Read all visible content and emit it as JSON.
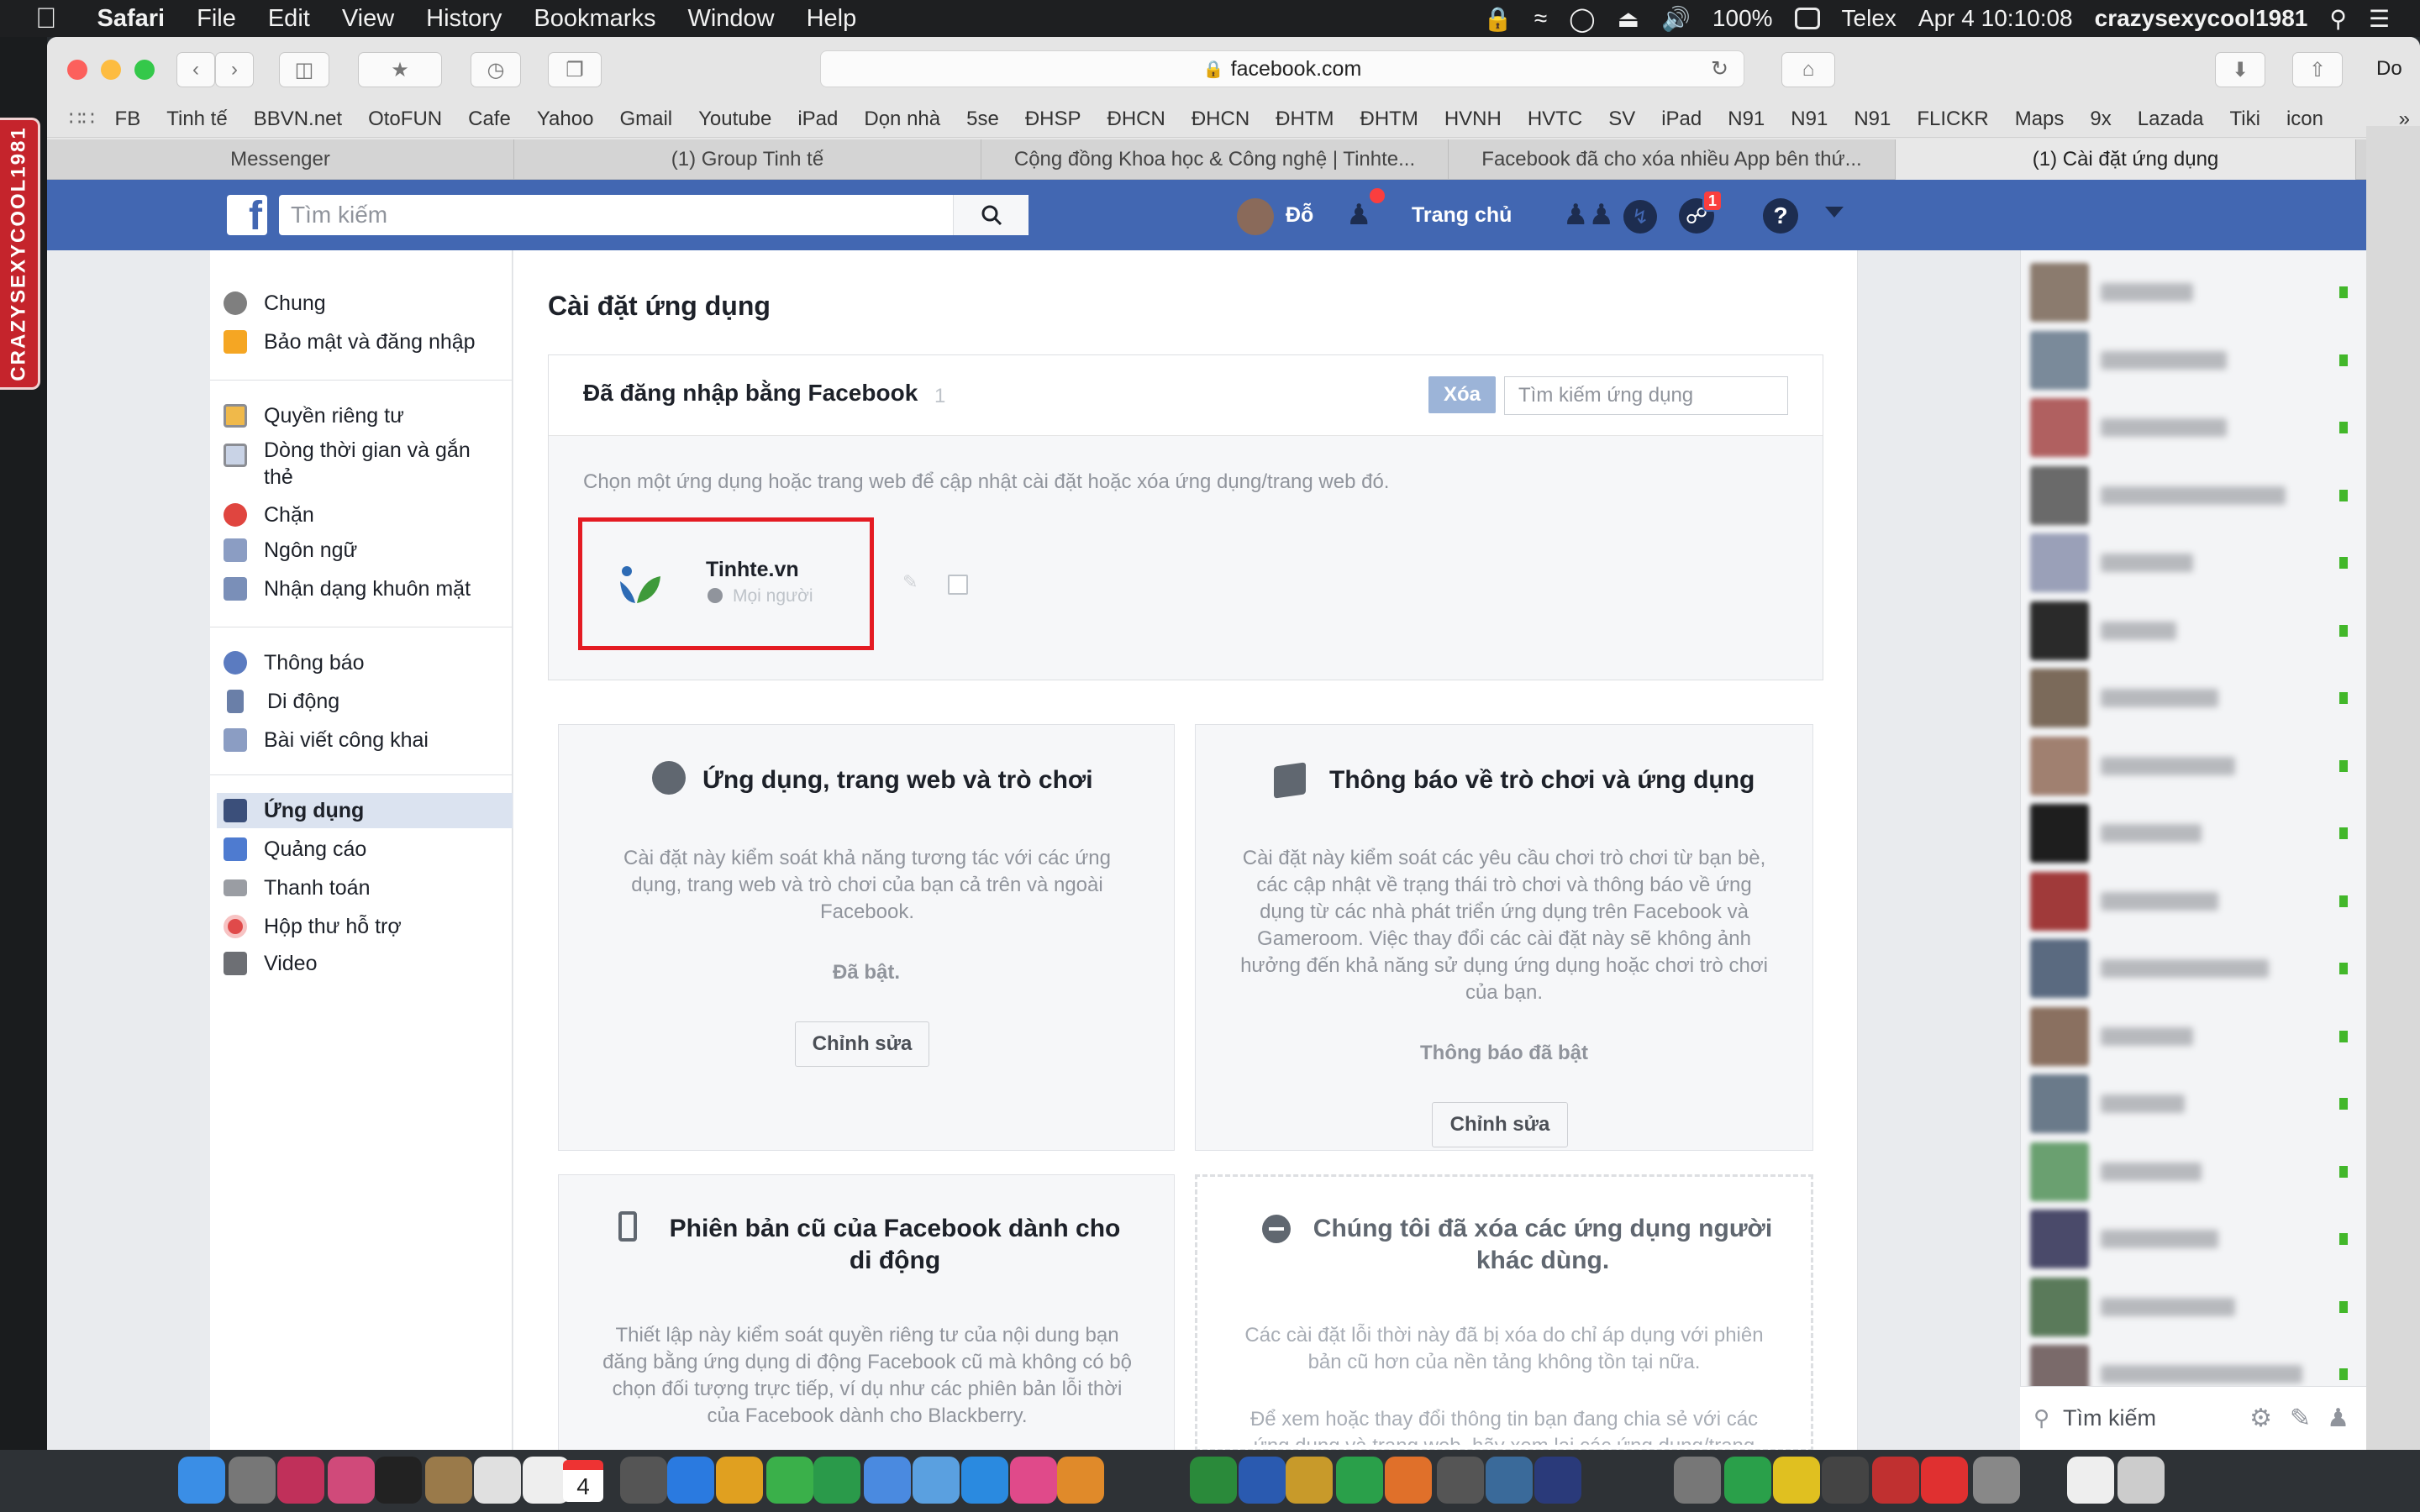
{
  "menubar": {
    "app": "Safari",
    "menus": [
      "File",
      "Edit",
      "View",
      "History",
      "Bookmarks",
      "Window",
      "Help"
    ],
    "battery": "100%",
    "input_method": "Telex",
    "clock": "Apr 4  10:10:08",
    "user": "crazysexycool1981"
  },
  "stamp_text": "CRAZYSEXYCOOL1981",
  "browser": {
    "url": "facebook.com",
    "right_label": "Do",
    "bookmarks": [
      "FB",
      "Tinh tế",
      "BBVN.net",
      "OtoFUN",
      "Cafe",
      "Yahoo",
      "Gmail",
      "Youtube",
      "iPad",
      "Dọn nhà",
      "5se",
      "ĐHSP",
      "ĐHCN",
      "ĐHCN",
      "ĐHTM",
      "ĐHTM",
      "HVNH",
      "HVTC",
      "SV",
      "iPad",
      "N91",
      "N91",
      "N91",
      "FLICKR",
      "Maps",
      "9x",
      "Lazada",
      "Tiki",
      "icon"
    ],
    "tabs": [
      "Messenger",
      "(1) Group Tinh tế",
      "Cộng đồng Khoa học & Công nghệ | Tinhte...",
      "Facebook đã cho xóa nhiều App bên thứ...",
      "(1) Cài đặt ứng dụng"
    ]
  },
  "fb_header": {
    "logo": "f",
    "search_placeholder": "Tìm kiếm",
    "user_name": "Đỗ",
    "home": "Trang chủ",
    "notif_count": "1"
  },
  "left_nav": {
    "group1": [
      "Chung",
      "Bảo mật và đăng nhập"
    ],
    "group2": [
      "Quyền riêng tư",
      "Dòng thời gian và gắn thẻ",
      "Chặn",
      "Ngôn ngữ",
      "Nhận dạng khuôn mặt"
    ],
    "group3": [
      "Thông báo",
      "Di động",
      "Bài viết công khai"
    ],
    "group4": [
      "Ứng dụng",
      "Quảng cáo",
      "Thanh toán",
      "Hộp thư hỗ trợ",
      "Video"
    ]
  },
  "main": {
    "title": "Cài đặt ứng dụng",
    "logged_in_title": "Đã đăng nhập bằng Facebook",
    "logged_in_count": "1",
    "remove_button": "Xóa",
    "app_search_placeholder": "Tìm kiếm ứng dụng",
    "hint": "Chọn một ứng dụng hoặc trang web để cập nhật cài đặt hoặc xóa ứng dụng/trang web đó.",
    "app_name": "Tinhte.vn",
    "app_visibility": "Mọi người",
    "cards": [
      {
        "title": "Ứng dụng, trang web và trò chơi",
        "text": "Cài đặt này kiểm soát khả năng tương tác với các ứng dụng, trang web và trò chơi của bạn cả trên và ngoài Facebook.",
        "status": "Đã bật.",
        "button": "Chỉnh sửa"
      },
      {
        "title": "Thông báo về trò chơi và ứng dụng",
        "text": "Cài đặt này kiểm soát các yêu cầu chơi trò chơi từ bạn bè, các cập nhật về trạng thái trò chơi và thông báo về ứng dụng từ các nhà phát triển ứng dụng trên Facebook và Gameroom. Việc thay đổi các cài đặt này sẽ không ảnh hưởng đến khả năng sử dụng ứng dụng hoặc chơi trò chơi của bạn.",
        "status": "Thông báo đã bật",
        "button": "Chỉnh sửa"
      },
      {
        "title": "Phiên bản cũ của Facebook dành cho di động",
        "text": "Thiết lập này kiểm soát quyền riêng tư của nội dung bạn đăng bằng ứng dụng di động Facebook cũ mà không có bộ chọn đối tượng trực tiếp, ví dụ như các phiên bản lỗi thời của Facebook dành cho Blackberry."
      },
      {
        "title": "Chúng tôi đã xóa các ứng dụng người khác dùng.",
        "text": "Các cài đặt lỗi thời này đã bị xóa do chỉ áp dụng với phiên bản cũ hơn của nền tảng không tồn tại nữa.",
        "text2": "Để xem hoặc thay đổi thông tin bạn đang chia sẻ với các ứng dụng và trang web, hãy xem lại các ứng dụng/trang"
      }
    ]
  },
  "chat": {
    "search_placeholder": "Tìm kiếm"
  },
  "dock": {
    "calendar_day": "4"
  },
  "colors": {
    "fb_blue": "#4267b2",
    "highlight_red": "#e41b23"
  }
}
